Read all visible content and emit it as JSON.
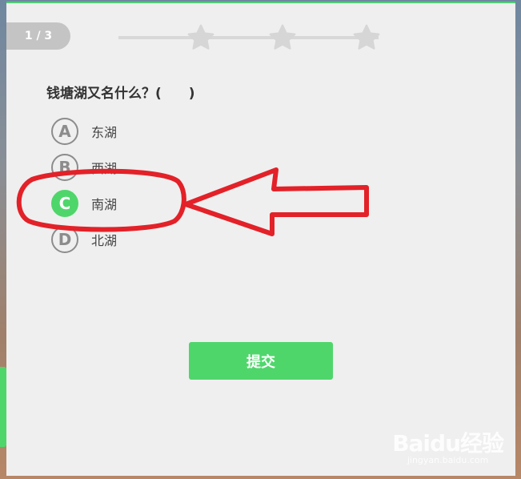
{
  "progress": {
    "text": "1 / 3",
    "stars_total": 3,
    "stars_filled": 0
  },
  "question": {
    "text": "钱塘湖又名什么？(　　)"
  },
  "options": [
    {
      "letter": "A",
      "label": "东湖",
      "selected": false
    },
    {
      "letter": "B",
      "label": "西湖",
      "selected": false
    },
    {
      "letter": "C",
      "label": "南湖",
      "selected": true
    },
    {
      "letter": "D",
      "label": "北湖",
      "selected": false
    }
  ],
  "submit": {
    "label": "提交"
  },
  "watermark": {
    "logo": "Baidu经验",
    "url": "jingyan.baidu.com"
  },
  "colors": {
    "accent": "#4fd66b",
    "card_bg": "#efefef",
    "annotation": "#e32128",
    "badge_gray": "#8c8c8c"
  },
  "icons": [
    "star-icon",
    "arrow-annotation",
    "circle-annotation"
  ]
}
